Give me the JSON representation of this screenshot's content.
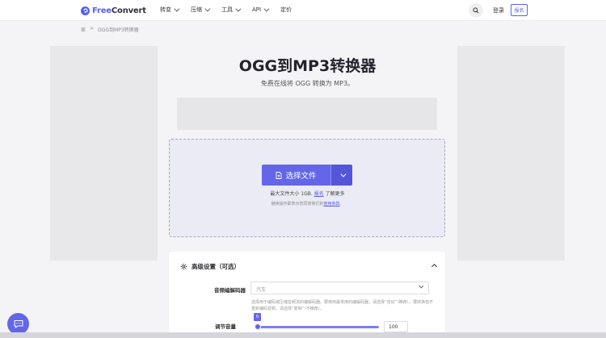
{
  "header": {
    "logo_free": "Free",
    "logo_convert": "Convert",
    "nav": [
      {
        "label": "转变"
      },
      {
        "label": "压缩"
      },
      {
        "label": "工具"
      },
      {
        "label": "API"
      },
      {
        "label": "定价"
      }
    ],
    "login": "登录",
    "signup": "报名"
  },
  "breadcrumb": {
    "home": "家",
    "sep": ">",
    "current": "OGG到MP3转换器"
  },
  "hero": {
    "title": "OGG到MP3转换器",
    "subtitle": "免费在线将 OGG 转换为 MP3。"
  },
  "upload": {
    "button_label": "选择文件",
    "limit_text": "最大文件大小 1GB.",
    "limit_link": "报名",
    "limit_suffix": " 了解更多",
    "terms_text": "继续操作即表示您同意我们的",
    "terms_link": "使用条款",
    "terms_suffix": "。"
  },
  "advanced": {
    "title": "高级设置（可选）",
    "codec_label": "音频编解码器",
    "codec_value": "汽车",
    "codec_help": "选择用于编码或压缩音频流的编解码器。要使用最常用的编解码器，请选择“自动”（推荐）。要转换但不重新编码音频，请选择“复制”（不推荐）。",
    "volume_label": "调节音量",
    "volume_badge": "0",
    "volume_value": "100"
  },
  "colors": {
    "accent": "#6366e8",
    "brand": "#5a5ef0"
  }
}
